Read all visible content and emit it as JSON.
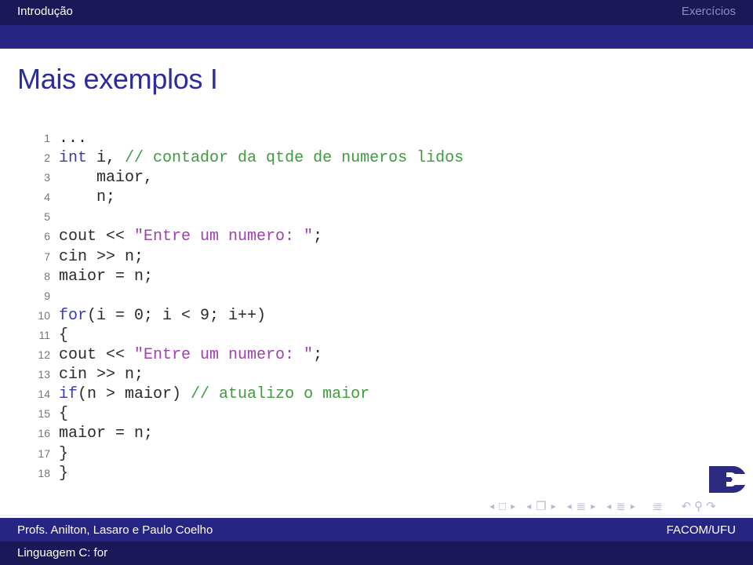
{
  "header": {
    "section_left": "Introdução",
    "section_right": "Exercícios"
  },
  "frame": {
    "title": "Mais exemplos I"
  },
  "code": {
    "language": "C++",
    "lines": [
      {
        "n": "1",
        "tokens": [
          {
            "t": "...",
            "c": ""
          }
        ]
      },
      {
        "n": "2",
        "tokens": [
          {
            "t": "int",
            "c": "kw"
          },
          {
            "t": " i, ",
            "c": ""
          },
          {
            "t": "// contador da qtde de numeros lidos",
            "c": "cm"
          }
        ]
      },
      {
        "n": "3",
        "tokens": [
          {
            "t": "    maior,",
            "c": ""
          }
        ]
      },
      {
        "n": "4",
        "tokens": [
          {
            "t": "    n;",
            "c": ""
          }
        ]
      },
      {
        "n": "5",
        "tokens": []
      },
      {
        "n": "6",
        "tokens": [
          {
            "t": "cout << ",
            "c": ""
          },
          {
            "t": "\"Entre um numero: \"",
            "c": "st"
          },
          {
            "t": ";",
            "c": ""
          }
        ]
      },
      {
        "n": "7",
        "tokens": [
          {
            "t": "cin >> n;",
            "c": ""
          }
        ]
      },
      {
        "n": "8",
        "tokens": [
          {
            "t": "maior = n;",
            "c": ""
          }
        ]
      },
      {
        "n": "9",
        "tokens": []
      },
      {
        "n": "10",
        "tokens": [
          {
            "t": "for",
            "c": "kw"
          },
          {
            "t": "(i = 0; i < 9; i++)",
            "c": ""
          }
        ]
      },
      {
        "n": "11",
        "tokens": [
          {
            "t": "{",
            "c": ""
          }
        ]
      },
      {
        "n": "12",
        "tokens": [
          {
            "t": "cout << ",
            "c": ""
          },
          {
            "t": "\"Entre um numero: \"",
            "c": "st"
          },
          {
            "t": ";",
            "c": ""
          }
        ]
      },
      {
        "n": "13",
        "tokens": [
          {
            "t": "cin >> n;",
            "c": ""
          }
        ]
      },
      {
        "n": "14",
        "tokens": [
          {
            "t": "if",
            "c": "kw"
          },
          {
            "t": "(n > maior) ",
            "c": ""
          },
          {
            "t": "// atualizo o maior",
            "c": "cm"
          }
        ]
      },
      {
        "n": "15",
        "tokens": [
          {
            "t": "{",
            "c": ""
          }
        ]
      },
      {
        "n": "16",
        "tokens": [
          {
            "t": "maior = n;",
            "c": ""
          }
        ]
      },
      {
        "n": "17",
        "tokens": [
          {
            "t": "}",
            "c": ""
          }
        ]
      },
      {
        "n": "18",
        "tokens": [
          {
            "t": "}",
            "c": ""
          }
        ]
      }
    ]
  },
  "logo": {
    "name": "facom-logo",
    "color": "#2b2a7e"
  },
  "navigation": {
    "icons": [
      {
        "name": "prev-slide-icon",
        "glyph": "◂"
      },
      {
        "name": "slide-icon",
        "glyph": "□"
      },
      {
        "name": "next-slide-icon",
        "glyph": "▸"
      },
      {
        "name": "prev-frame-icon",
        "glyph": "◂"
      },
      {
        "name": "frame-icon",
        "glyph": "❐"
      },
      {
        "name": "next-frame-icon",
        "glyph": "▸"
      },
      {
        "name": "prev-subsection-icon",
        "glyph": "◂"
      },
      {
        "name": "subsection-icon",
        "glyph": "≣"
      },
      {
        "name": "next-subsection-icon",
        "glyph": "▸"
      },
      {
        "name": "prev-section-icon",
        "glyph": "◂"
      },
      {
        "name": "section-icon",
        "glyph": "≣"
      },
      {
        "name": "next-section-icon",
        "glyph": "▸"
      },
      {
        "name": "document-icon",
        "glyph": "≣"
      },
      {
        "name": "undo-icon",
        "glyph": "↶"
      },
      {
        "name": "search-icon",
        "glyph": "⚲"
      },
      {
        "name": "redo-icon",
        "glyph": "↷"
      }
    ]
  },
  "footer": {
    "authors": "Profs. Anilton, Lasaro e Paulo Coelho",
    "institution": "FACOM/UFU",
    "short_title": "Linguagem C: for"
  },
  "colors": {
    "header_dark": "#1b1858",
    "header_mid": "#262583",
    "title": "#2c2c9a",
    "keyword": "#3b3bb0",
    "comment": "#3f9a3f",
    "string": "#a040b0"
  }
}
